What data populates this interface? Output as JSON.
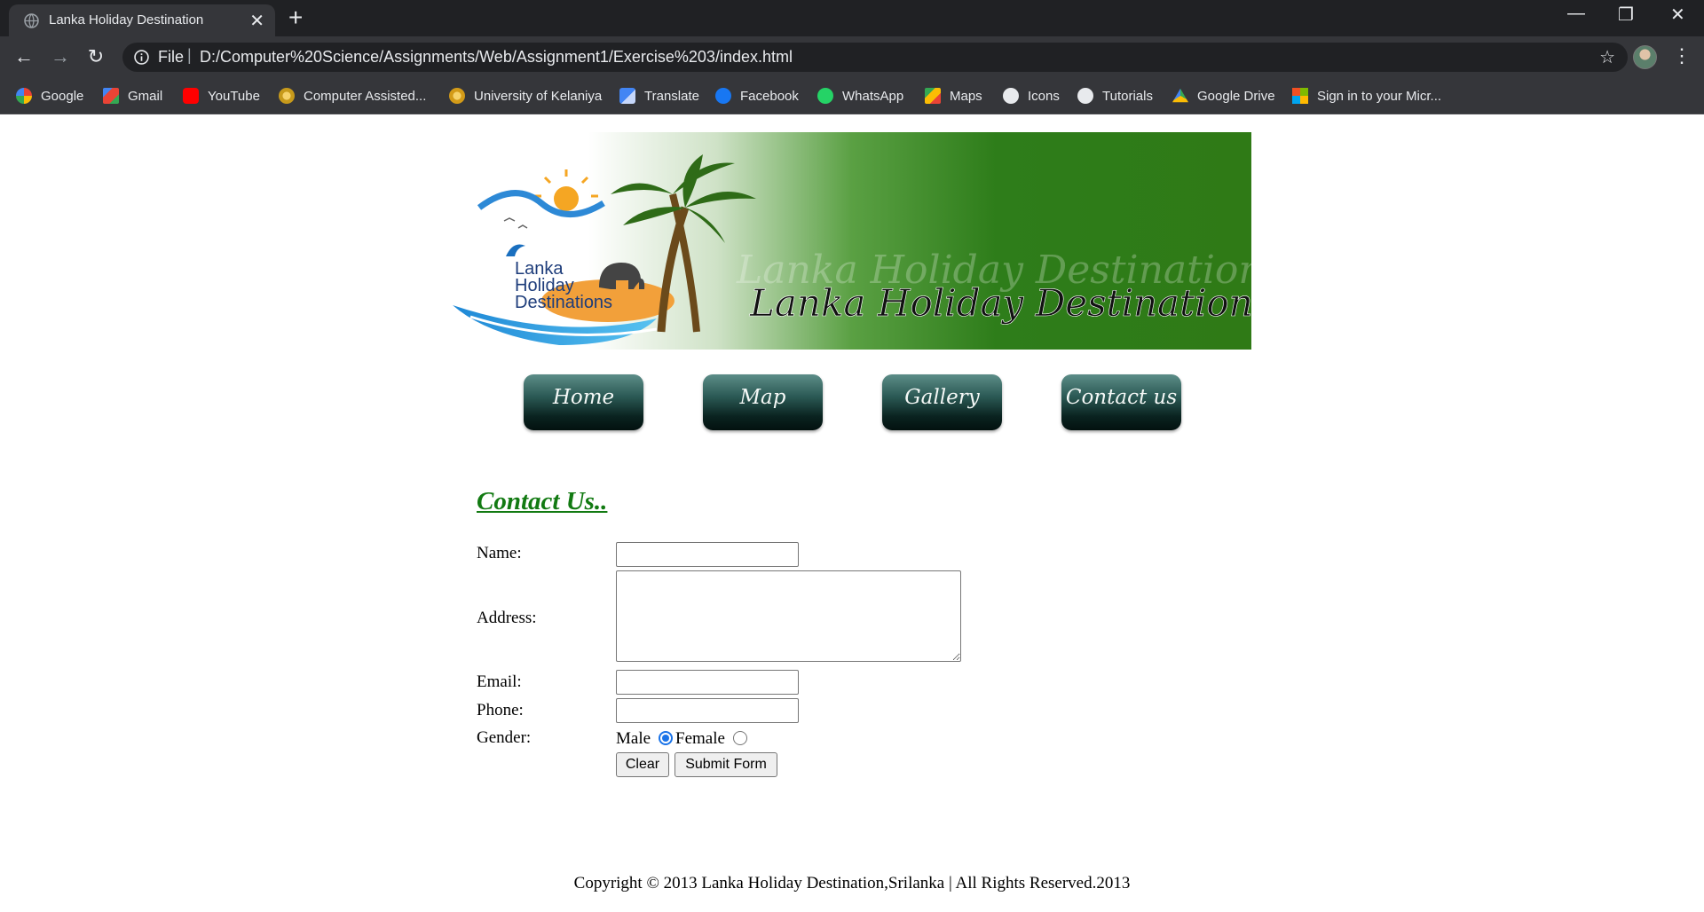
{
  "browser": {
    "tab_title": "Lanka Holiday Destination",
    "new_tab_label": "+",
    "close_tab_label": "✕",
    "window_controls": {
      "minimize": "—",
      "restore": "❐",
      "close": "✕"
    },
    "nav": {
      "back": "←",
      "forward": "→",
      "reload": "↻"
    },
    "address": {
      "scheme_label": "File",
      "separator": "|",
      "url": "D:/Computer%20Science/Assignments/Web/Assignment1/Exercise%203/index.html"
    },
    "star": "☆",
    "menu": "⋮",
    "bookmarks": [
      {
        "label": "Google",
        "icon": "google-icon",
        "color": "#4285f4"
      },
      {
        "label": "Gmail",
        "icon": "gmail-icon",
        "color": "#ea4335"
      },
      {
        "label": "YouTube",
        "icon": "youtube-icon",
        "color": "#ff0000"
      },
      {
        "label": "Computer Assisted...",
        "icon": "university-seal-icon",
        "color": "#c79a1b"
      },
      {
        "label": "University of Kelaniya",
        "icon": "university-seal-icon",
        "color": "#d39b18"
      },
      {
        "label": "Translate",
        "icon": "translate-icon",
        "color": "#4285f4"
      },
      {
        "label": "Facebook",
        "icon": "facebook-icon",
        "color": "#1877f2"
      },
      {
        "label": "WhatsApp",
        "icon": "whatsapp-icon",
        "color": "#25d366"
      },
      {
        "label": "Maps",
        "icon": "maps-icon",
        "color": "#34a853"
      },
      {
        "label": "Icons",
        "icon": "globe-icon",
        "color": "#e8eaed"
      },
      {
        "label": "Tutorials",
        "icon": "globe-icon",
        "color": "#e8eaed"
      },
      {
        "label": "Google Drive",
        "icon": "drive-icon",
        "color": "#fbbc04"
      },
      {
        "label": "Sign in to your Micr...",
        "icon": "microsoft-icon",
        "color": "#f25022"
      }
    ]
  },
  "banner": {
    "logo_line1": "Lanka",
    "logo_line2": "Holiday",
    "logo_line3": "Destinations",
    "title": "Lanka Holiday Destination",
    "accent_color": "#2e7d1a"
  },
  "menu": {
    "home": "Home",
    "map": "Map",
    "gallery": "Gallery",
    "contact": "Contact us"
  },
  "contact": {
    "heading": "Contact Us..",
    "name_label": "Name:",
    "address_label": "Address:",
    "email_label": "Email:",
    "phone_label": "Phone:",
    "gender_label": "Gender:",
    "gender_male": "Male",
    "gender_female": "Female",
    "selected_gender": "Male",
    "name_value": "",
    "address_value": "",
    "email_value": "",
    "phone_value": "",
    "clear_label": "Clear",
    "submit_label": "Submit Form"
  },
  "footer": {
    "text": "Copyright © 2013 Lanka Holiday Destination,Srilanka | All Rights Reserved.2013"
  }
}
